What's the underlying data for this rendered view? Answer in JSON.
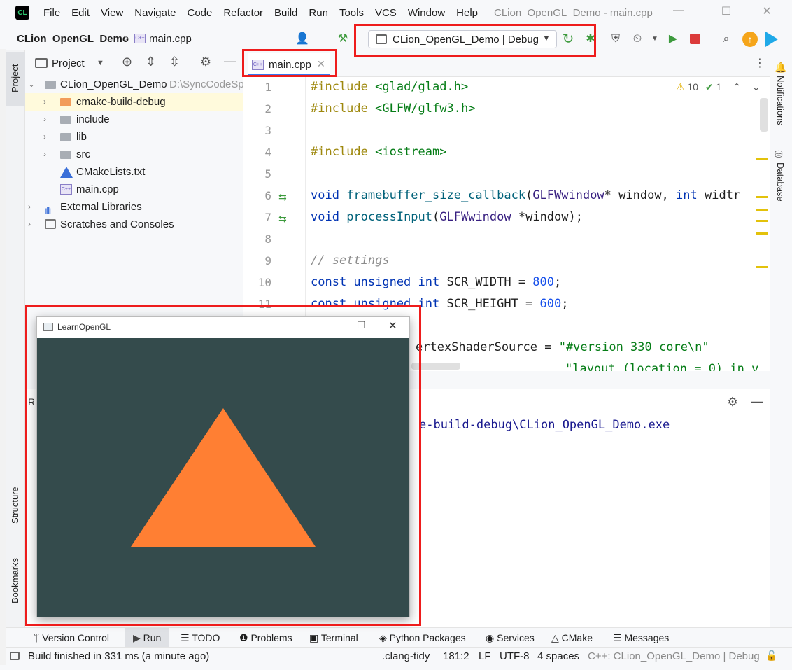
{
  "menu": [
    "File",
    "Edit",
    "View",
    "Navigate",
    "Code",
    "Refactor",
    "Build",
    "Run",
    "Tools",
    "VCS",
    "Window",
    "Help"
  ],
  "window_title": "CLion_OpenGL_Demo - main.cpp",
  "breadcrumb": {
    "project": "CLion_OpenGL_Demo",
    "file": "main.cpp"
  },
  "run_config": "CLion_OpenGL_Demo | Debug",
  "project_panel": {
    "title": "Project",
    "tree": [
      {
        "label": "CLion_OpenGL_Demo",
        "path": "D:\\SyncCodeSp",
        "type": "root"
      },
      {
        "label": "cmake-build-debug",
        "type": "folder-orange"
      },
      {
        "label": "include",
        "type": "folder"
      },
      {
        "label": "lib",
        "type": "folder"
      },
      {
        "label": "src",
        "type": "folder"
      },
      {
        "label": "CMakeLists.txt",
        "type": "cmake"
      },
      {
        "label": "main.cpp",
        "type": "cpp"
      },
      {
        "label": "External Libraries",
        "type": "libs"
      },
      {
        "label": "Scratches and Consoles",
        "type": "scratch"
      }
    ]
  },
  "editor": {
    "tab": "main.cpp",
    "warnings": "10",
    "typos": "1",
    "line_numbers": [
      "1",
      "2",
      "3",
      "4",
      "5",
      "6",
      "7",
      "8",
      "9",
      "10",
      "11"
    ]
  },
  "right_tools": {
    "notifications": "Notifications",
    "database": "Database"
  },
  "left_tools": {
    "project": "Project",
    "structure": "Structure",
    "bookmarks": "Bookmarks"
  },
  "run_panel": {
    "title": "Ru",
    "output": "e-build-debug\\CLion_OpenGL_Demo.exe"
  },
  "gl_window": {
    "title": "LearnOpenGL",
    "bg": "#344b4c",
    "triangle": "#ff7f33"
  },
  "bottom_tabs": [
    "Version Control",
    "Run",
    "TODO",
    "Problems",
    "Terminal",
    "Python Packages",
    "Services",
    "CMake",
    "Messages"
  ],
  "status": {
    "message": "Build finished in 331 ms (a minute ago)",
    "linter": ".clang-tidy",
    "position": "181:2",
    "line_ending": "LF",
    "encoding": "UTF-8",
    "indent": "4 spaces",
    "context": "C++: CLion_OpenGL_Demo | Debug"
  },
  "colors": {
    "highlight_box": "#ee1c1c",
    "accent": "#3574f0"
  }
}
